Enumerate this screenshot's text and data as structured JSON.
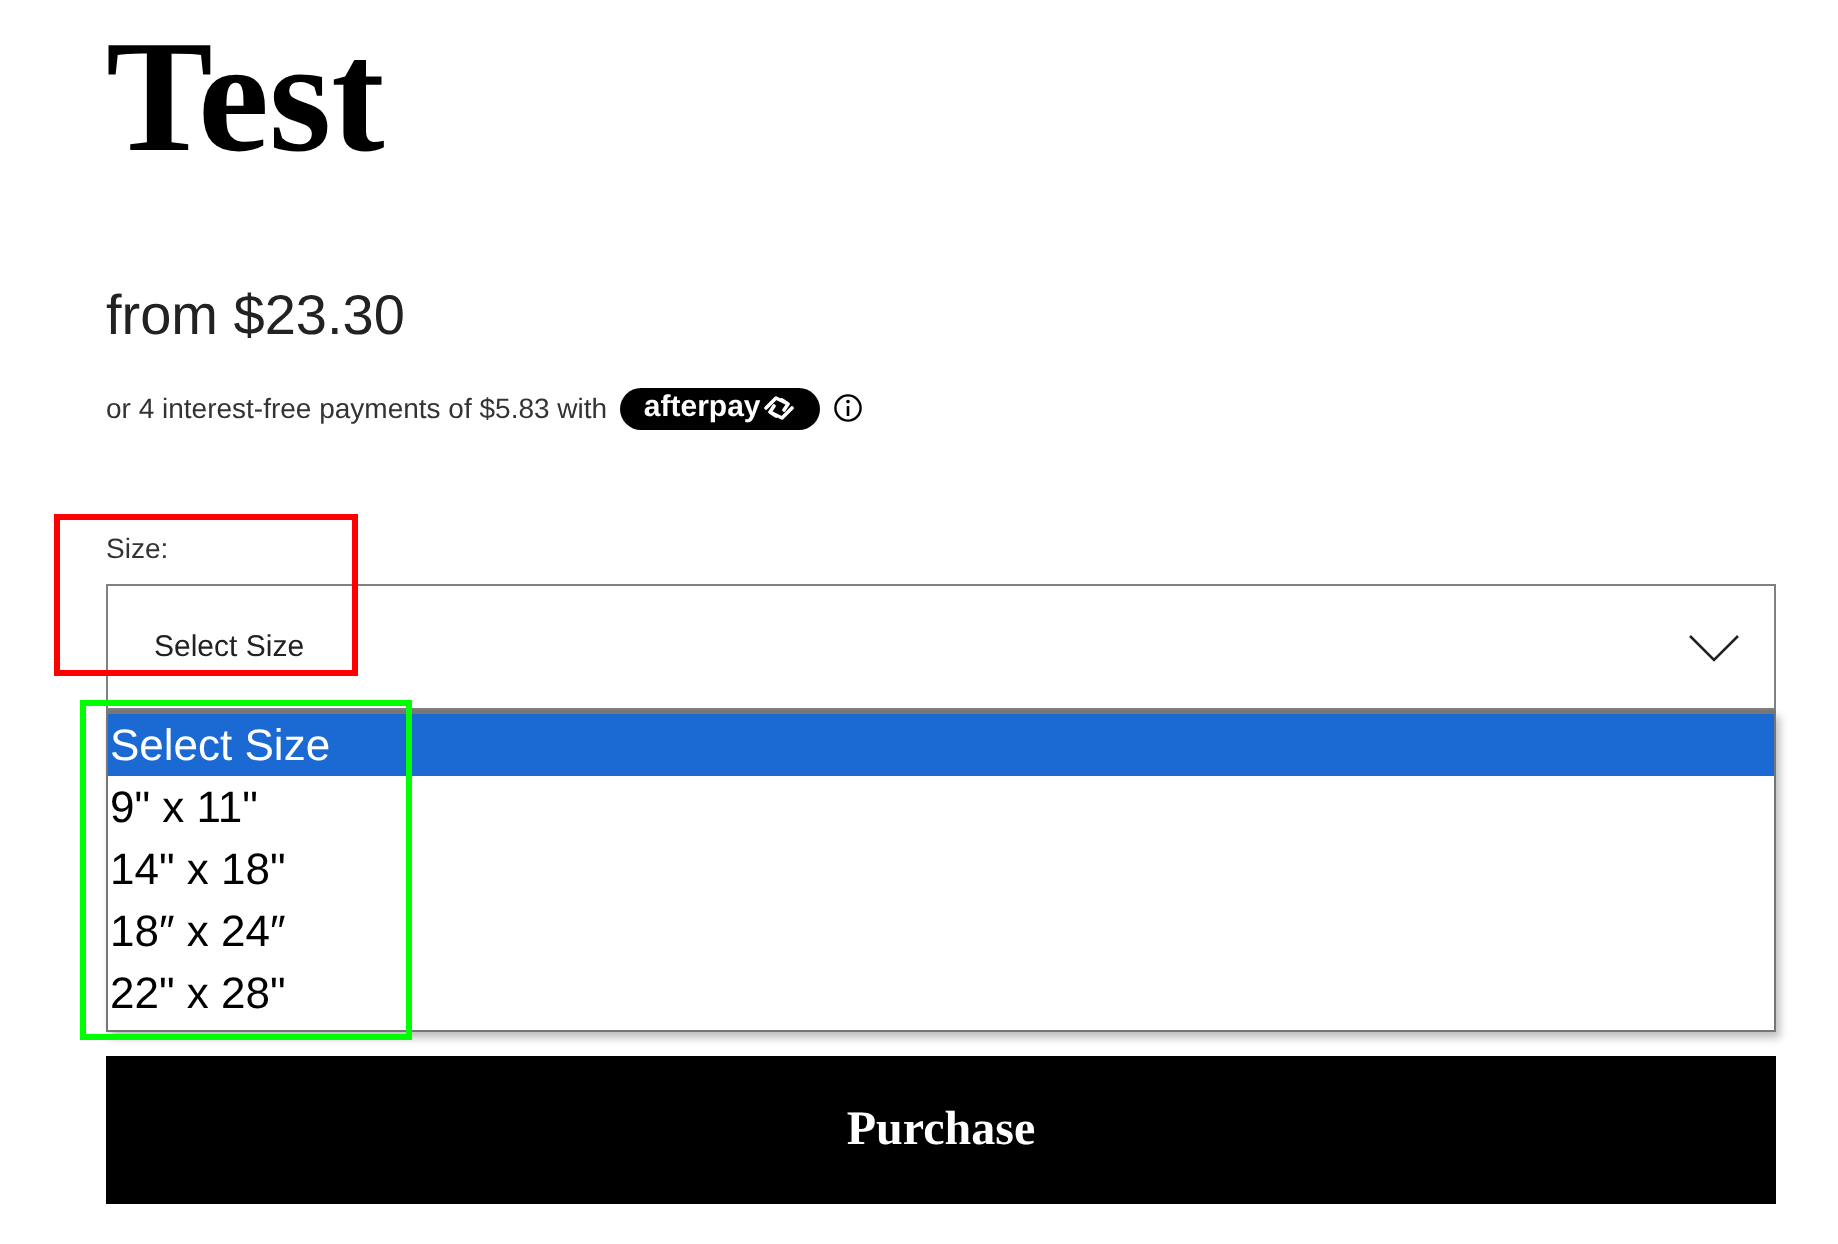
{
  "product": {
    "title": "Test",
    "price": "from $23.30",
    "installments": {
      "text": "or 4 interest-free payments of $5.83 with",
      "provider": "afterpay"
    }
  },
  "size_select": {
    "label": "Size:",
    "value": "Select Size",
    "expanded": true,
    "options": [
      {
        "label": "Select Size",
        "selected": true
      },
      {
        "label": "9\" x 11\"",
        "selected": false
      },
      {
        "label": "14\" x 18\"",
        "selected": false
      },
      {
        "label": "18″ x 24″",
        "selected": false
      },
      {
        "label": "22\" x 28\"",
        "selected": false
      }
    ]
  },
  "purchase_button": {
    "label": "Purchase"
  },
  "annotations": [
    {
      "kind": "rectangle",
      "color": "#ff0000"
    },
    {
      "kind": "rectangle",
      "color": "#00ff00"
    }
  ]
}
